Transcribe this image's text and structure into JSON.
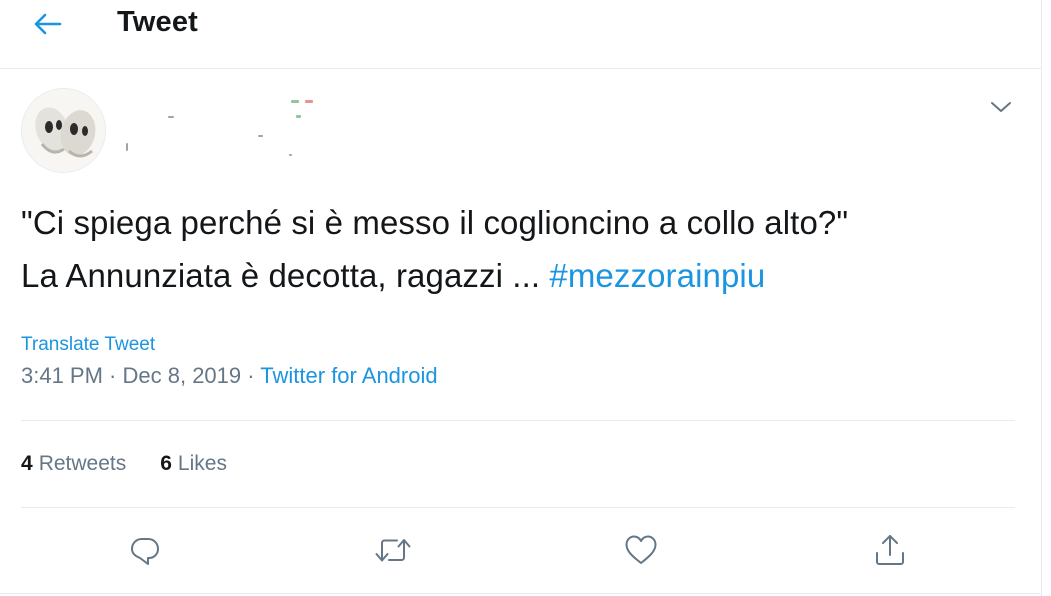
{
  "header": {
    "back_icon": "arrow-left-icon",
    "title": "Tweet"
  },
  "tweet": {
    "author": {
      "name": "",
      "handle": "",
      "avatar": "avatar-image"
    },
    "text_part1": "\"Ci spiega perché si è messo il coglioncino a collo alto?\"",
    "text_part2": "La Annunziata è decotta, ragazzi ... ",
    "hashtag": "#mezzorainpiu",
    "translate_label": "Translate Tweet",
    "time": "3:41 PM",
    "separator": " · ",
    "date": "Dec 8, 2019",
    "source": "Twitter for Android"
  },
  "stats": {
    "retweets_count": "4",
    "retweets_label": "Retweets",
    "likes_count": "6",
    "likes_label": "Likes"
  },
  "actions": {
    "reply_icon": "reply-icon",
    "retweet_icon": "retweet-icon",
    "like_icon": "heart-icon",
    "share_icon": "share-icon"
  },
  "colors": {
    "accent": "#1b95e0",
    "text": "#14171a",
    "secondary": "#657786",
    "border": "#e6ecf0"
  }
}
